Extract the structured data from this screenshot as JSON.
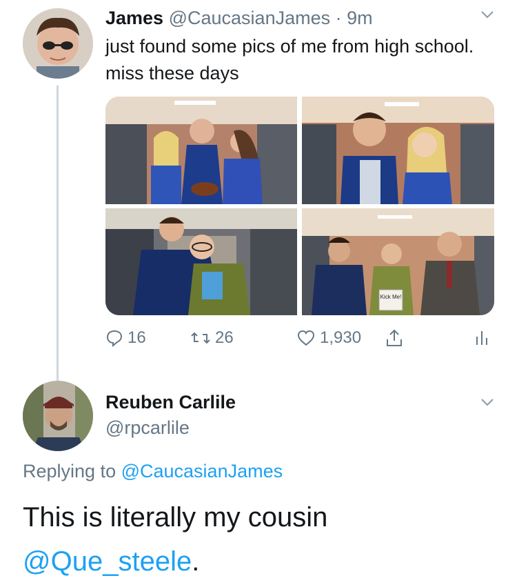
{
  "tweet": {
    "display_name": "James",
    "handle": "@CaucasianJames",
    "separator": " · ",
    "time": "9m",
    "text": "just found some pics of me from high school. miss these days",
    "photo_note": "Kick Me!",
    "reply_count": "16",
    "retweet_count": "26",
    "like_count": "1,930",
    "icons": [
      "chevron-down-icon",
      "reply-icon",
      "retweet-icon",
      "like-icon",
      "share-icon",
      "analytics-icon"
    ]
  },
  "reply": {
    "display_name": "Reuben Carlile",
    "handle": "@rpcarlile",
    "replying_prefix": "Replying to ",
    "replying_handle": "@CaucasianJames",
    "text": "This is literally my cousin",
    "mention": "@Que_steele",
    "trailing": "."
  },
  "colors": {
    "text": "#14171a",
    "secondary": "#657786",
    "link": "#1da1f2",
    "thread_line": "#ccd6dd"
  }
}
